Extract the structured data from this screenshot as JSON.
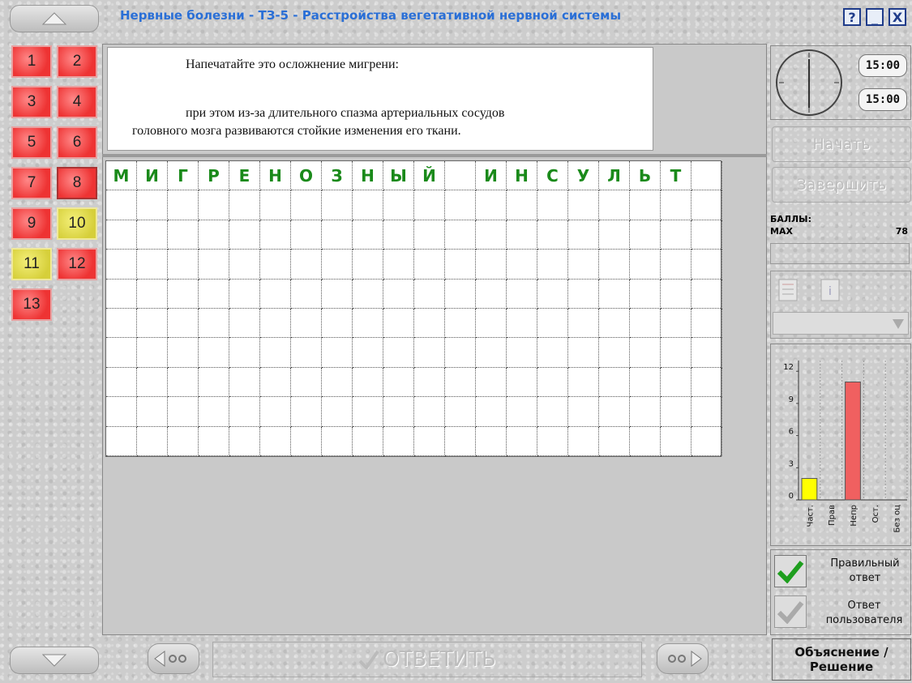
{
  "window": {
    "title": "Нервные болезни - ТЗ-5 - Расстройства вегетативной нервной системы",
    "help_label": "?",
    "minimize_label": "_",
    "close_label": "X"
  },
  "questions": [
    {
      "label": "1",
      "state": "red"
    },
    {
      "label": "2",
      "state": "red"
    },
    {
      "label": "3",
      "state": "red"
    },
    {
      "label": "4",
      "state": "red"
    },
    {
      "label": "5",
      "state": "red"
    },
    {
      "label": "6",
      "state": "red"
    },
    {
      "label": "7",
      "state": "red"
    },
    {
      "label": "8",
      "state": "red-selected"
    },
    {
      "label": "9",
      "state": "red"
    },
    {
      "label": "10",
      "state": "yellow"
    },
    {
      "label": "11",
      "state": "yellow"
    },
    {
      "label": "12",
      "state": "red"
    },
    {
      "label": "13",
      "state": "red"
    }
  ],
  "question": {
    "line1": "Напечатайте это осложнение мигрени:",
    "line2": "при этом из-за длительного спазма артериальных сосудов",
    "line3": "головного мозга развиваются стойкие изменения его ткани."
  },
  "answer_letters": [
    "М",
    "И",
    "Г",
    "Р",
    "Е",
    "Н",
    "О",
    "З",
    "Н",
    "Ы",
    "Й",
    "",
    "И",
    "Н",
    "С",
    "У",
    "Л",
    "Ь",
    "Т",
    ""
  ],
  "timer": {
    "total": "15:00",
    "remaining": "15:00"
  },
  "buttons": {
    "start": "Начать",
    "finish": "Завершить",
    "answer": "ОТВЕТИТЬ",
    "explain_line1": "Объяснение /",
    "explain_line2": "Решение"
  },
  "score": {
    "label": "БАЛЛЫ:",
    "max_label": "MAX",
    "max_value": "78"
  },
  "legend": {
    "correct_line1": "Правильный",
    "correct_line2": "ответ",
    "user_line1": "Ответ",
    "user_line2": "пользователя"
  },
  "colors": {
    "red": "#e33",
    "yellow": "#ffff00",
    "bar_wrong": "#f06060",
    "letters": "#1a8a1a"
  },
  "chart_data": {
    "type": "bar",
    "categories": [
      "Част.",
      "Прав",
      "Непр",
      "Ост.",
      "Без оц"
    ],
    "values": [
      2,
      0,
      11,
      0,
      0
    ],
    "ylim": [
      0,
      13
    ],
    "yticks": [
      0,
      3,
      6,
      9,
      12
    ],
    "bar_colors": [
      "#ffff00",
      "#ffff00",
      "#f06060",
      "#cccccc",
      "#cccccc"
    ],
    "grid": true
  }
}
